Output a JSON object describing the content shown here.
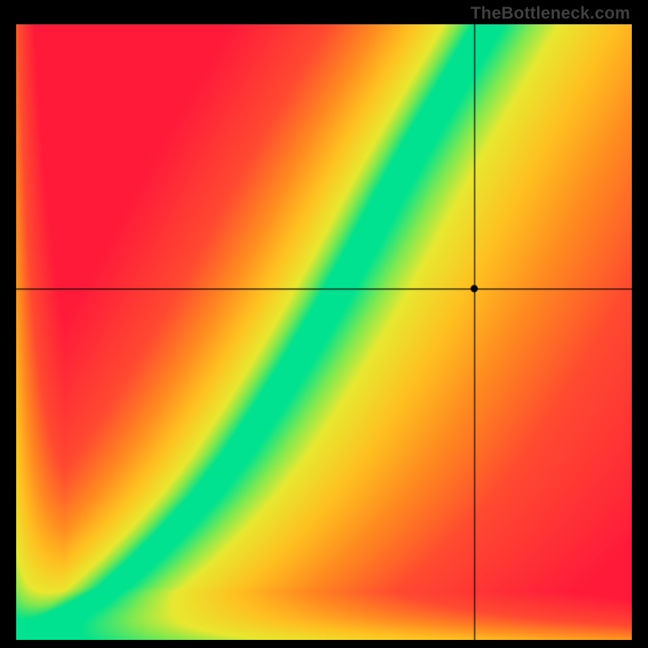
{
  "watermark": "TheBottleneck.com",
  "chart_data": {
    "type": "heatmap",
    "title": "",
    "xlabel": "",
    "ylabel": "",
    "xlim": [
      0,
      1
    ],
    "ylim": [
      0,
      1
    ],
    "crosshair": {
      "x": 0.745,
      "y": 0.57
    },
    "marker": {
      "x": 0.745,
      "y": 0.57
    },
    "ridge_curve": {
      "description": "green optimal band center (x is horizontal fraction, y is vertical fraction from bottom)",
      "points": [
        [
          0.0,
          0.0
        ],
        [
          0.05,
          0.03
        ],
        [
          0.1,
          0.055
        ],
        [
          0.15,
          0.085
        ],
        [
          0.2,
          0.13
        ],
        [
          0.25,
          0.18
        ],
        [
          0.3,
          0.235
        ],
        [
          0.35,
          0.3
        ],
        [
          0.4,
          0.375
        ],
        [
          0.45,
          0.455
        ],
        [
          0.5,
          0.54
        ],
        [
          0.55,
          0.63
        ],
        [
          0.6,
          0.725
        ],
        [
          0.65,
          0.815
        ],
        [
          0.7,
          0.9
        ],
        [
          0.75,
          0.985
        ]
      ]
    },
    "ridge_band_width": 0.06,
    "color_stops": {
      "description": "distance-from-ridge to color mapping",
      "stops": [
        {
          "d": 0.0,
          "color": "#00E28F"
        },
        {
          "d": 0.06,
          "color": "#7FE850"
        },
        {
          "d": 0.12,
          "color": "#E8E830"
        },
        {
          "d": 0.25,
          "color": "#FFC020"
        },
        {
          "d": 0.4,
          "color": "#FF8A20"
        },
        {
          "d": 0.6,
          "color": "#FF4A30"
        },
        {
          "d": 1.0,
          "color": "#FF1A3A"
        }
      ]
    }
  }
}
